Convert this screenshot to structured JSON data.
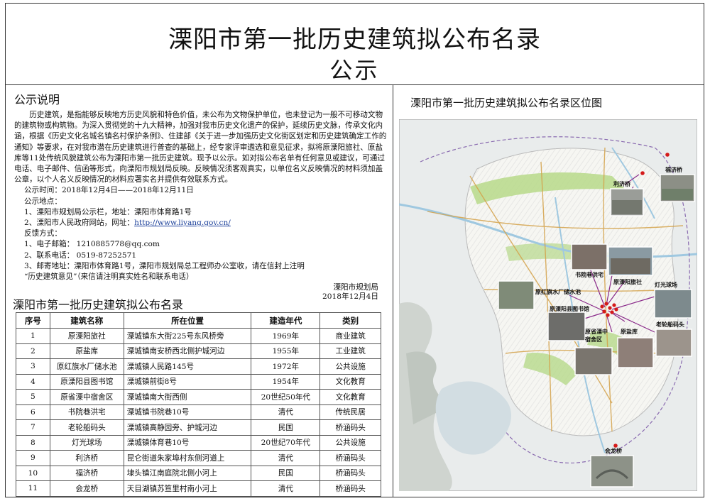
{
  "header": {
    "title_line1": "溧阳市第一批历史建筑拟公布名录",
    "title_line2": "公示"
  },
  "notice": {
    "heading": "公示说明",
    "body": "历史建筑，是指能够反映地方历史风貌和特色价值，未公布为文物保护单位，也未登记为一般不可移动文物的建筑物或构筑物。为深入贯彻党的十九大精神，加强对我市历史文化遗产的保护，延续历史文脉，传承文化内涵，根据《历史文化名城名镇名村保护条例》、住建部《关于进一步加强历史文化街区划定和历史建筑确定工作的通知》等要求，在对我市潜在历史建筑进行普查的基础上，经专家评审遴选和意见征求，拟将原溧阳旅社、原盐库等11处传统风貌建筑公布为溧阳市第一批历史建筑。现予以公示。如对拟公布名单有任何意见或建议，可通过电话、电子邮件、信函等形式，向溧阳市规划局反映。反映情况须客观真实，以单位名义反映情况的材料须加盖公章，以个人名义反映情况的材料应署实名并提供有效联系方式。",
    "time_line": "公示时间：2018年12月4日——2018年12月11日",
    "place_heading": "公示地点：",
    "place_1": "1、溧阳市规划局公示栏，地址：溧阳市体育路1号",
    "place_2_prefix": "2、溧阳市人民政府网站，网址：",
    "place_2_url": "http://www.liyang.gov.cn/",
    "feedback_heading": "反馈方式：",
    "feedback_1": "1、电子邮箱：  1210885778@qq.com",
    "feedback_2": "2、联系电话：  0519-87252571",
    "feedback_3": "3、邮寄地址：溧阳市体育路1号，溧阳市规划局总工程师办公室收，请在信封上注明",
    "feedback_3b": "“历史建筑意见”（来信请注明真实姓名和联系电话）",
    "sign_org": "溧阳市规划局",
    "sign_date": "2018年12月4日"
  },
  "list": {
    "heading": "溧阳市第一批历史建筑拟公布名录",
    "columns": [
      "序号",
      "建筑名称",
      "所在位置",
      "建造年代",
      "类别"
    ],
    "rows": [
      [
        "1",
        "原溧阳旅社",
        "溧城镇东大街225号东风桥旁",
        "1969年",
        "商业建筑"
      ],
      [
        "2",
        "原盐库",
        "溧城镇南安桥西北侧护城河边",
        "1955年",
        "工业建筑"
      ],
      [
        "3",
        "原红旗水厂储水池",
        "溧城镇人民路145号",
        "1972年",
        "公共设施"
      ],
      [
        "4",
        "原溧阳县图书馆",
        "溧城镇前街8号",
        "1954年",
        "文化教育"
      ],
      [
        "5",
        "原省溧中宿舍区",
        "溧城镇南大街西侧",
        "20世纪50年代",
        "文化教育"
      ],
      [
        "6",
        "书院巷洪宅",
        "溧城镇书院巷10号",
        "清代",
        "传统民居"
      ],
      [
        "7",
        "老轮船码头",
        "溧城镇高静园旁、护城河边",
        "民国",
        "桥涵码头"
      ],
      [
        "8",
        "灯光球场",
        "溧城镇体育巷10号",
        "20世纪70年代",
        "公共设施"
      ],
      [
        "9",
        "利济桥",
        "昆仑街道朱家埠村东侧河道上",
        "清代",
        "桥涵码头"
      ],
      [
        "10",
        "福济桥",
        "埭头镇江南庭院北侧小河上",
        "民国",
        "桥涵码头"
      ],
      [
        "11",
        "会龙桥",
        "天目湖镇苏笪里村南小河上",
        "清代",
        "桥涵码头"
      ]
    ]
  },
  "map": {
    "heading": "溧阳市第一批历史建筑拟公布名录区位图",
    "labels": {
      "fuji": "福济桥",
      "liji": "利济桥",
      "shuyuan": "书院巷洪宅",
      "lvshe": "原溧阳旅社",
      "shuichi": "原红旗水厂储水池",
      "tushuguan": "原溧阳县图书馆",
      "dengguang": "灯光球场",
      "sushe_1": "原省溧中",
      "sushe_2": "宿舍区",
      "yanku": "原盐库",
      "matou": "老轮船码头",
      "huilong": "会龙桥"
    },
    "colors": {
      "marker": "#d41a1a",
      "leader": "#8a2a8a",
      "green": "#b7d98a",
      "water": "#9fc8e0"
    }
  }
}
